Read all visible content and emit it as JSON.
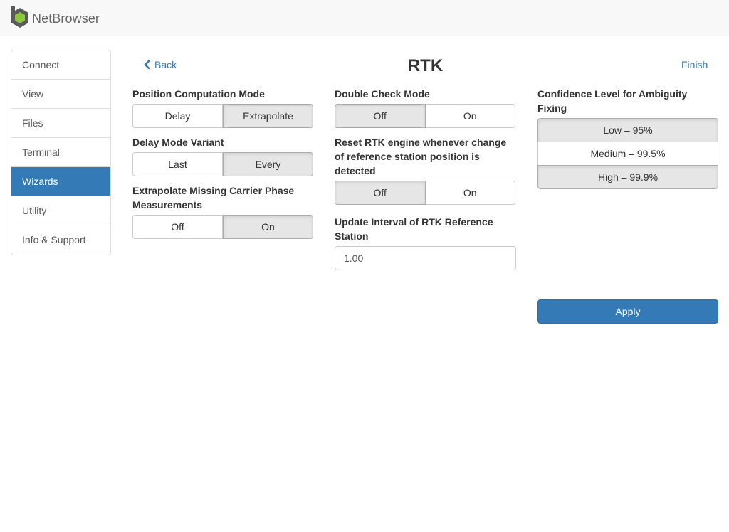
{
  "app": {
    "brand": "NetBrowser",
    "accent": "#337ab7",
    "logo_color": "#8dc63f"
  },
  "sidebar": {
    "items": [
      {
        "label": "Connect"
      },
      {
        "label": "View"
      },
      {
        "label": "Files"
      },
      {
        "label": "Terminal"
      },
      {
        "label": "Wizards",
        "active": true
      },
      {
        "label": "Utility"
      },
      {
        "label": "Info & Support"
      }
    ]
  },
  "header": {
    "back_label": "Back",
    "title": "RTK",
    "finish_label": "Finish",
    "back_icon": "chevron-left-icon"
  },
  "settings": {
    "position_mode": {
      "label": "Position Computation Mode",
      "options": [
        "Delay",
        "Extrapolate"
      ],
      "selected": "Extrapolate"
    },
    "delay_variant": {
      "label": "Delay Mode Variant",
      "options": [
        "Last",
        "Every"
      ],
      "selected": "Every"
    },
    "extrapolate_missing": {
      "label": "Extrapolate Missing Carrier Phase Measurements",
      "options": [
        "Off",
        "On"
      ],
      "selected": "On"
    },
    "double_check": {
      "label": "Double Check Mode",
      "options": [
        "Off",
        "On"
      ],
      "selected": "Off"
    },
    "reset_engine": {
      "label": "Reset RTK engine whenever change of reference station position is detected",
      "options": [
        "Off",
        "On"
      ],
      "selected": "Off"
    },
    "update_interval": {
      "label": "Update Interval of RTK Reference Station",
      "value": "1.00"
    },
    "confidence": {
      "label": "Confidence Level for Ambiguity Fixing",
      "options": [
        "Low – 95%",
        "Medium – 99.5%",
        "High – 99.9%"
      ],
      "selected": [
        "Low – 95%",
        "High – 99.9%"
      ]
    }
  },
  "actions": {
    "apply_label": "Apply"
  }
}
